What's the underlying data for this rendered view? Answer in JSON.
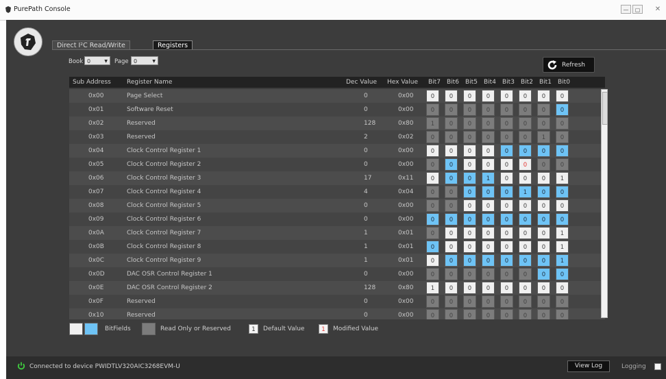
{
  "window": {
    "title": "PurePath Console",
    "minimize": "—",
    "maximize": "▢",
    "close": "✕"
  },
  "tabs": [
    {
      "label": "Direct I²C Read/Write",
      "active": false
    },
    {
      "label": "Registers",
      "active": true
    }
  ],
  "controls": {
    "book_label": "Book",
    "book_value": "0",
    "page_label": "Page",
    "page_value": "0",
    "refresh_label": "Refresh"
  },
  "columns": {
    "sub": "Sub Address",
    "name": "Register Name",
    "dec": "Dec Value",
    "hex": "Hex Value",
    "bits": [
      "Bit7",
      "Bit6",
      "Bit5",
      "Bit4",
      "Bit3",
      "Bit2",
      "Bit1",
      "Bit0"
    ]
  },
  "colors": {
    "bitfield": "#6ec3f5",
    "readonly": "#7c7c7c",
    "default_cell": "#f0f0f0",
    "modified": "#e53935"
  },
  "rows": [
    {
      "sub": "0x00",
      "name": "Page Select",
      "dec": "0",
      "hex": "0x00",
      "bits": [
        [
          "0",
          "w"
        ],
        [
          "0",
          "w"
        ],
        [
          "0",
          "w"
        ],
        [
          "0",
          "w"
        ],
        [
          "0",
          "w"
        ],
        [
          "0",
          "w"
        ],
        [
          "0",
          "w"
        ],
        [
          "0",
          "w"
        ]
      ]
    },
    {
      "sub": "0x01",
      "name": "Software Reset",
      "dec": "0",
      "hex": "0x00",
      "bits": [
        [
          "0",
          "g"
        ],
        [
          "0",
          "g"
        ],
        [
          "0",
          "g"
        ],
        [
          "0",
          "g"
        ],
        [
          "0",
          "g"
        ],
        [
          "0",
          "g"
        ],
        [
          "0",
          "g"
        ],
        [
          "0",
          "b"
        ]
      ]
    },
    {
      "sub": "0x02",
      "name": "Reserved",
      "dec": "128",
      "hex": "0x80",
      "bits": [
        [
          "1",
          "g"
        ],
        [
          "0",
          "g"
        ],
        [
          "0",
          "g"
        ],
        [
          "0",
          "g"
        ],
        [
          "0",
          "g"
        ],
        [
          "0",
          "g"
        ],
        [
          "0",
          "g"
        ],
        [
          "0",
          "g"
        ]
      ]
    },
    {
      "sub": "0x03",
      "name": "Reserved",
      "dec": "2",
      "hex": "0x02",
      "bits": [
        [
          "0",
          "g"
        ],
        [
          "0",
          "g"
        ],
        [
          "0",
          "g"
        ],
        [
          "0",
          "g"
        ],
        [
          "0",
          "g"
        ],
        [
          "0",
          "g"
        ],
        [
          "1",
          "g"
        ],
        [
          "0",
          "g"
        ]
      ]
    },
    {
      "sub": "0x04",
      "name": "Clock Control Register 1",
      "dec": "0",
      "hex": "0x00",
      "bits": [
        [
          "0",
          "w"
        ],
        [
          "0",
          "w"
        ],
        [
          "0",
          "w"
        ],
        [
          "0",
          "w"
        ],
        [
          "0",
          "b"
        ],
        [
          "0",
          "b"
        ],
        [
          "0",
          "b"
        ],
        [
          "0",
          "b"
        ]
      ]
    },
    {
      "sub": "0x05",
      "name": "Clock Control Register 2",
      "dec": "0",
      "hex": "0x00",
      "bits": [
        [
          "0",
          "g"
        ],
        [
          "0",
          "b"
        ],
        [
          "0",
          "w"
        ],
        [
          "0",
          "w"
        ],
        [
          "0",
          "w"
        ],
        [
          "0",
          "m"
        ],
        [
          "0",
          "g"
        ],
        [
          "0",
          "g"
        ]
      ]
    },
    {
      "sub": "0x06",
      "name": "Clock Control Register 3",
      "dec": "17",
      "hex": "0x11",
      "bits": [
        [
          "0",
          "w"
        ],
        [
          "0",
          "b"
        ],
        [
          "0",
          "b"
        ],
        [
          "1",
          "b"
        ],
        [
          "0",
          "w"
        ],
        [
          "0",
          "w"
        ],
        [
          "0",
          "w"
        ],
        [
          "1",
          "w"
        ]
      ]
    },
    {
      "sub": "0x07",
      "name": "Clock Control Register 4",
      "dec": "4",
      "hex": "0x04",
      "bits": [
        [
          "0",
          "g"
        ],
        [
          "0",
          "g"
        ],
        [
          "0",
          "b"
        ],
        [
          "0",
          "b"
        ],
        [
          "0",
          "b"
        ],
        [
          "1",
          "b"
        ],
        [
          "0",
          "b"
        ],
        [
          "0",
          "b"
        ]
      ]
    },
    {
      "sub": "0x08",
      "name": "Clock Control Register 5",
      "dec": "0",
      "hex": "0x00",
      "bits": [
        [
          "0",
          "g"
        ],
        [
          "0",
          "g"
        ],
        [
          "0",
          "w"
        ],
        [
          "0",
          "w"
        ],
        [
          "0",
          "w"
        ],
        [
          "0",
          "w"
        ],
        [
          "0",
          "w"
        ],
        [
          "0",
          "w"
        ]
      ]
    },
    {
      "sub": "0x09",
      "name": "Clock Control Register 6",
      "dec": "0",
      "hex": "0x00",
      "bits": [
        [
          "0",
          "b"
        ],
        [
          "0",
          "b"
        ],
        [
          "0",
          "b"
        ],
        [
          "0",
          "b"
        ],
        [
          "0",
          "b"
        ],
        [
          "0",
          "b"
        ],
        [
          "0",
          "b"
        ],
        [
          "0",
          "b"
        ]
      ]
    },
    {
      "sub": "0x0A",
      "name": "Clock Control Register 7",
      "dec": "1",
      "hex": "0x01",
      "bits": [
        [
          "0",
          "g"
        ],
        [
          "0",
          "w"
        ],
        [
          "0",
          "w"
        ],
        [
          "0",
          "w"
        ],
        [
          "0",
          "w"
        ],
        [
          "0",
          "w"
        ],
        [
          "0",
          "w"
        ],
        [
          "1",
          "w"
        ]
      ]
    },
    {
      "sub": "0x0B",
      "name": "Clock Control Register 8",
      "dec": "1",
      "hex": "0x01",
      "bits": [
        [
          "0",
          "b"
        ],
        [
          "0",
          "w"
        ],
        [
          "0",
          "w"
        ],
        [
          "0",
          "w"
        ],
        [
          "0",
          "w"
        ],
        [
          "0",
          "w"
        ],
        [
          "0",
          "w"
        ],
        [
          "1",
          "w"
        ]
      ]
    },
    {
      "sub": "0x0C",
      "name": "Clock Control Register 9",
      "dec": "1",
      "hex": "0x01",
      "bits": [
        [
          "0",
          "w"
        ],
        [
          "0",
          "b"
        ],
        [
          "0",
          "b"
        ],
        [
          "0",
          "b"
        ],
        [
          "0",
          "b"
        ],
        [
          "0",
          "b"
        ],
        [
          "0",
          "b"
        ],
        [
          "1",
          "b"
        ]
      ]
    },
    {
      "sub": "0x0D",
      "name": "DAC OSR Control Register 1",
      "dec": "0",
      "hex": "0x00",
      "bits": [
        [
          "0",
          "g"
        ],
        [
          "0",
          "g"
        ],
        [
          "0",
          "g"
        ],
        [
          "0",
          "g"
        ],
        [
          "0",
          "g"
        ],
        [
          "0",
          "g"
        ],
        [
          "0",
          "b"
        ],
        [
          "0",
          "b"
        ]
      ]
    },
    {
      "sub": "0x0E",
      "name": "DAC OSR Control Register 2",
      "dec": "128",
      "hex": "0x80",
      "bits": [
        [
          "1",
          "w"
        ],
        [
          "0",
          "w"
        ],
        [
          "0",
          "w"
        ],
        [
          "0",
          "w"
        ],
        [
          "0",
          "w"
        ],
        [
          "0",
          "w"
        ],
        [
          "0",
          "w"
        ],
        [
          "0",
          "w"
        ]
      ]
    },
    {
      "sub": "0x0F",
      "name": "Reserved",
      "dec": "0",
      "hex": "0x00",
      "bits": [
        [
          "0",
          "g"
        ],
        [
          "0",
          "g"
        ],
        [
          "0",
          "g"
        ],
        [
          "0",
          "g"
        ],
        [
          "0",
          "g"
        ],
        [
          "0",
          "g"
        ],
        [
          "0",
          "g"
        ],
        [
          "0",
          "g"
        ]
      ]
    },
    {
      "sub": "0x10",
      "name": "Reserved",
      "dec": "0",
      "hex": "0x00",
      "bits": [
        [
          "0",
          "g"
        ],
        [
          "0",
          "g"
        ],
        [
          "0",
          "g"
        ],
        [
          "0",
          "g"
        ],
        [
          "0",
          "g"
        ],
        [
          "0",
          "g"
        ],
        [
          "0",
          "g"
        ],
        [
          "0",
          "g"
        ]
      ]
    }
  ],
  "legend": {
    "bitfields": "BitFields",
    "readonly": "Read Only or Reserved",
    "default_value": "Default Value",
    "default_sample": "1",
    "modified_value": "Modified Value",
    "modified_sample": "1"
  },
  "status": {
    "connected_text": "Connected to device PWIDTLV320AIC3268EVM-U",
    "view_log": "View Log",
    "logging": "Logging"
  }
}
